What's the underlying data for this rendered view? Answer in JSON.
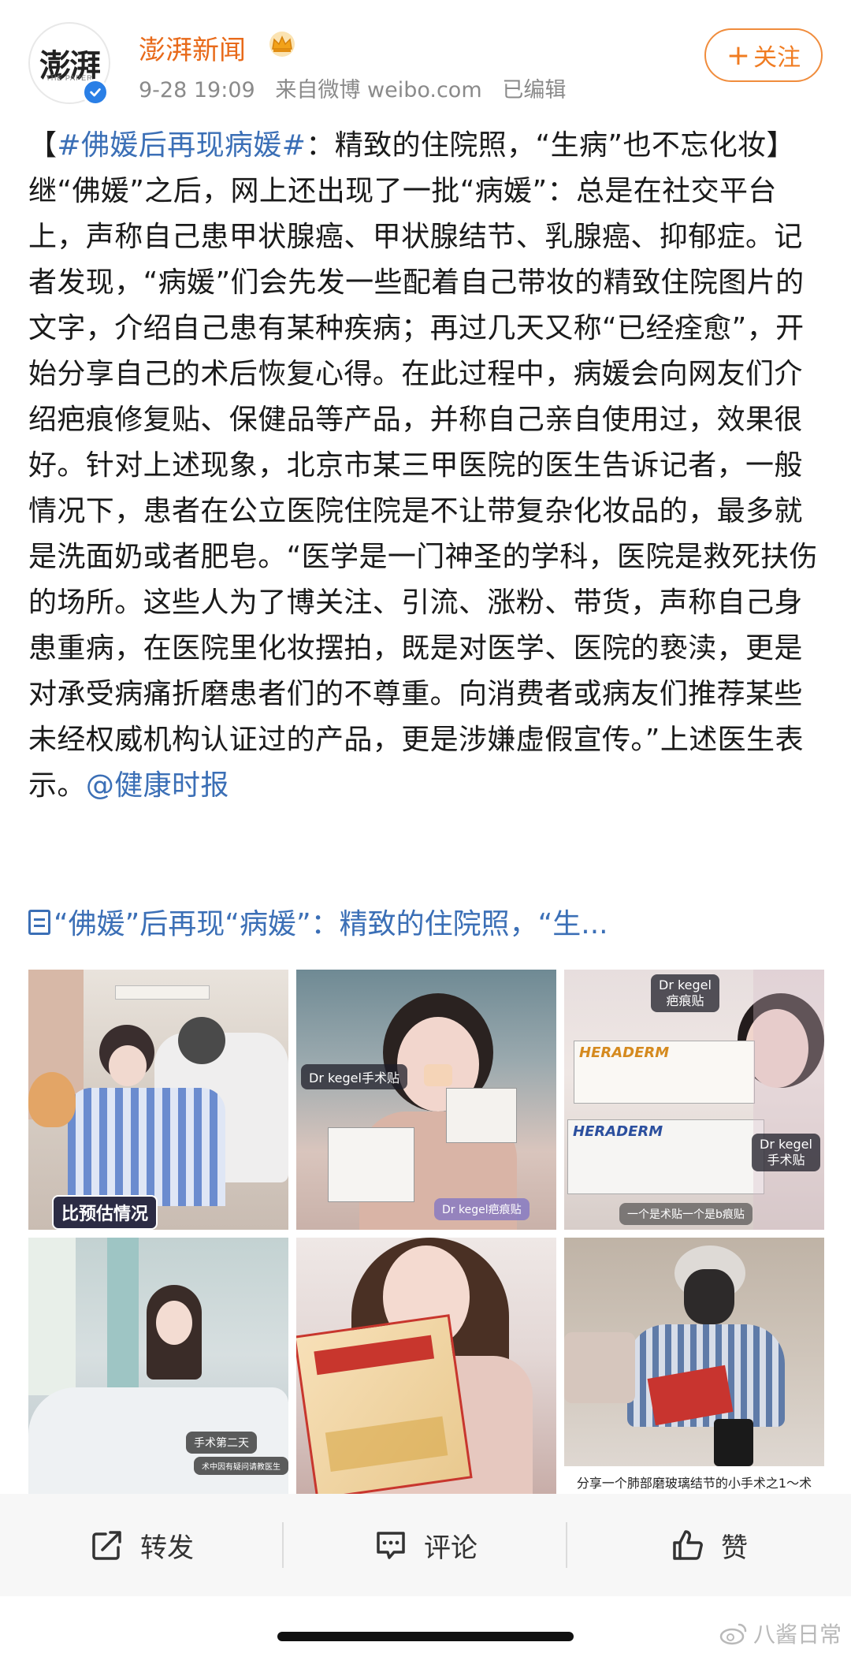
{
  "header": {
    "avatar_text": "澎湃",
    "avatar_sub": "THE PAPER",
    "account_name": "澎湃新闻",
    "time": "9-28 19:09",
    "source": "来自微博 weibo.com",
    "edited": "已编辑",
    "follow_label": "关注",
    "follow_plus": "+"
  },
  "post": {
    "hashtag": "#佛媛后再现病媛#",
    "text_open": "【",
    "text_after_hashtag": "：精致的住院照，“生病”也不忘化妆】继“佛媛”之后，网上还出现了一批“病媛”：总是在社交平台上，声称自己患甲状腺癌、甲状腺结节、乳腺癌、抑郁症。记者发现，“病媛”们会先发一些配着自己带妆的精致住院图片的文字，介绍自己患有某种疾病；再过几天又称“已经痊愈”，开始分享自己的术后恢复心得。在此过程中，病媛会向网友们介绍疤痕修复贴、保健品等产品，并称自己亲自使用过，效果很好。针对上述现象，北京市某三甲医院的医生告诉记者，一般情况下，患者在公立医院住院是不让带复杂化妆品的，最多就是洗面奶或者肥皂。“医学是一门神圣的学科，医院是救死扶伤的场所。这些人为了博关注、引流、涨粉、带货，声称自己身患重病，在医院里化妆摆拍，既是对医学、医院的亵渎，更是对承受病痛折磨患者们的不尊重。向消费者或病友们推荐某些未经权威机构认证过的产品，更是涉嫌虚假宣传。”上述医生表示。",
    "mention": "@健康时报",
    "article_link": "“佛媛”后再现“病媛”：精致的住院照，“生..."
  },
  "images": [
    {
      "id": "img-1",
      "label": "比预估情况"
    },
    {
      "id": "img-2",
      "label_a": "Dr kegel手术贴",
      "label_b": "Dr kegel疤痕贴"
    },
    {
      "id": "img-3",
      "label_a": "Dr kegel",
      "label_a2": "疤痕贴",
      "label_b": "Dr kegel",
      "label_b2": "手术贴",
      "label_c": "一个是",
      "label_c2": "术贴一个是b痕贴",
      "brand": "HERADERM"
    },
    {
      "id": "img-4",
      "label_a": "手术第二天",
      "label_b": "术中因有疑问请教医生"
    },
    {
      "id": "img-5",
      "label": ""
    },
    {
      "id": "img-6",
      "caption": "分享一个肺部磨玻璃结节的小手术之1～术"
    }
  ],
  "actions": {
    "repost": "转发",
    "comment": "评论",
    "like": "赞"
  },
  "watermark": "八酱日常",
  "colors": {
    "account_orange": "#e86a1a",
    "link_blue": "#3b6fb6",
    "verified_blue": "#2a7fe6",
    "meta_gray": "#8a8a8a"
  }
}
